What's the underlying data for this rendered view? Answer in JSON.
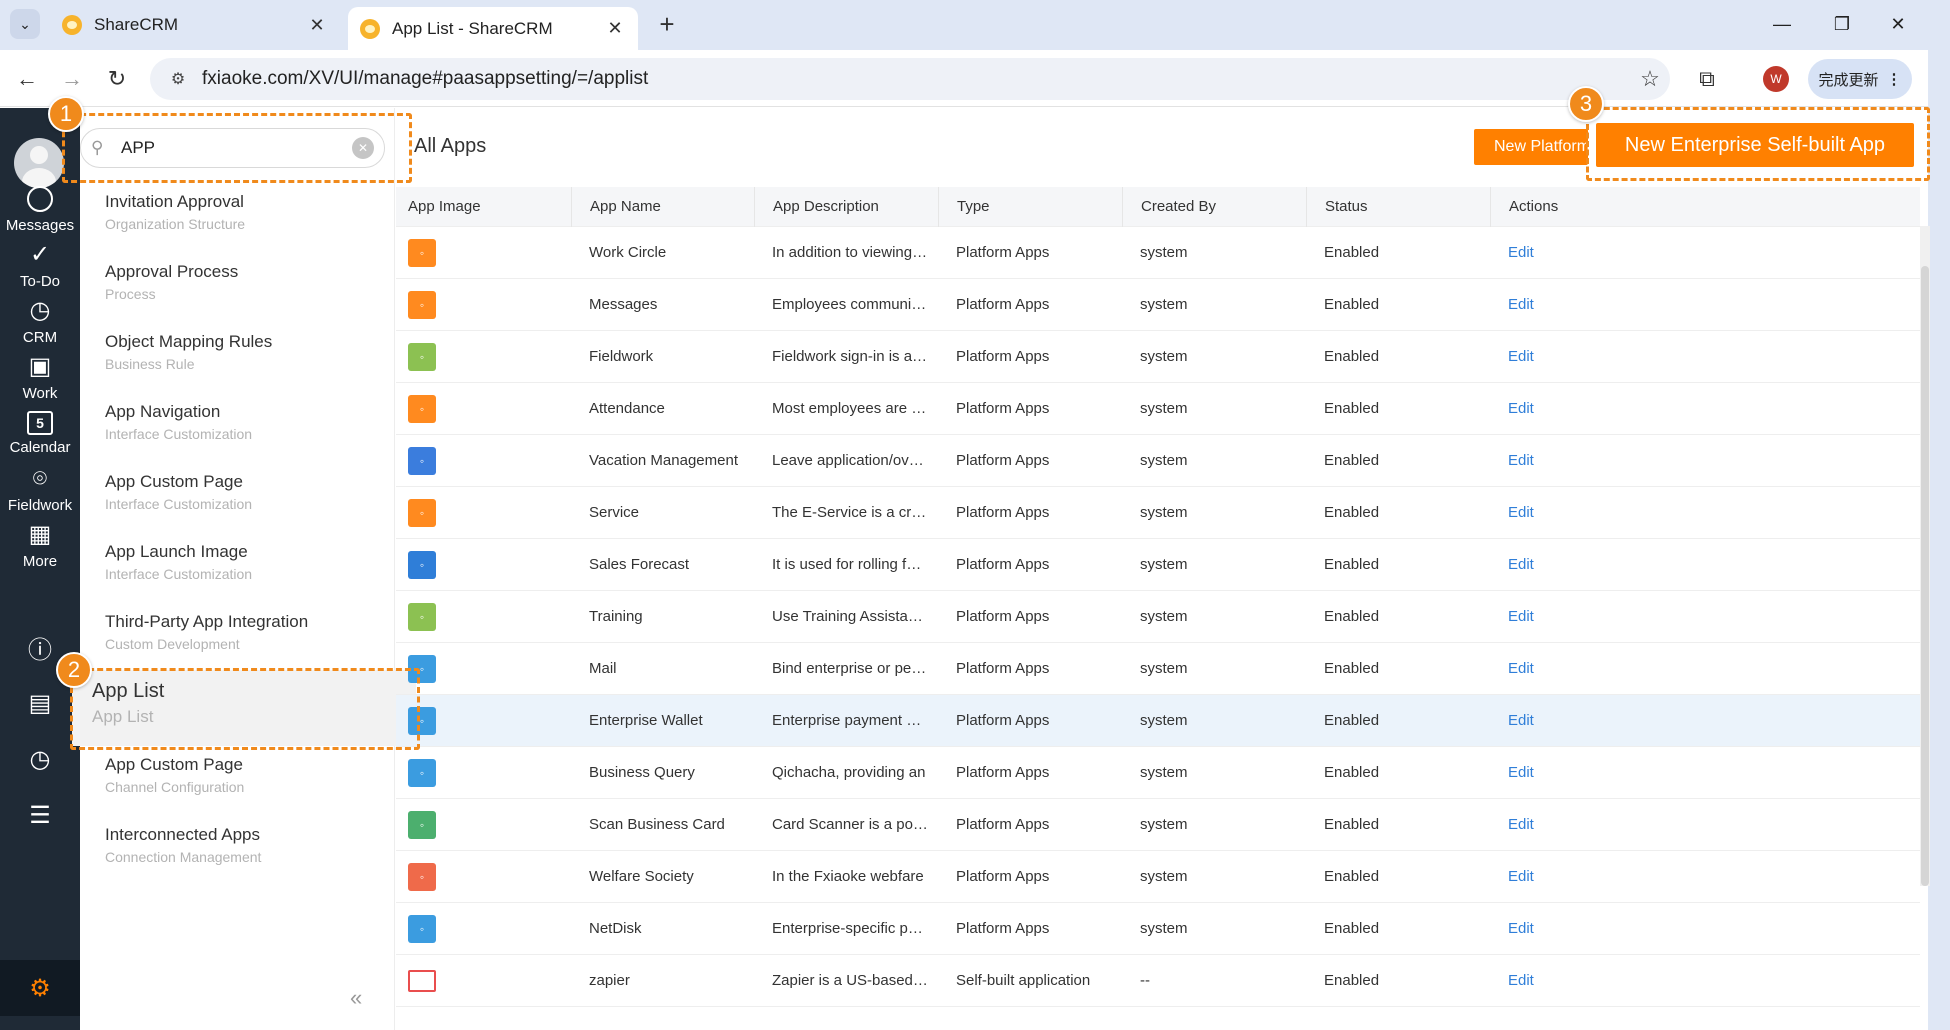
{
  "browser": {
    "tabs": [
      {
        "title": "ShareCRM",
        "active": false
      },
      {
        "title": "App List - ShareCRM",
        "active": true
      }
    ],
    "url": "fxiaoke.com/XV/UI/manage#paasappsetting/=/applist",
    "profile_initial": "W",
    "update_label": "完成更新"
  },
  "rail": {
    "items": [
      {
        "label": "Messages",
        "icon": "chat-bubble-icon"
      },
      {
        "label": "To-Do",
        "icon": "check-circle-icon"
      },
      {
        "label": "CRM",
        "icon": "clock-icon"
      },
      {
        "label": "Work",
        "icon": "briefcase-icon"
      },
      {
        "label": "Calendar",
        "icon": "calendar-icon",
        "day": "5"
      },
      {
        "label": "Fieldwork",
        "icon": "location-pin-icon"
      },
      {
        "label": "More",
        "icon": "grid-icon"
      }
    ]
  },
  "sidebar": {
    "search_value": "APP",
    "items": [
      {
        "title": "Invitation Approval",
        "subtitle": "Organization Structure"
      },
      {
        "title": "Approval Process",
        "subtitle": "Process"
      },
      {
        "title": "Object Mapping Rules",
        "subtitle": "Business Rule"
      },
      {
        "title": "App Navigation",
        "subtitle": "Interface Customization"
      },
      {
        "title": "App Custom Page",
        "subtitle": "Interface Customization"
      },
      {
        "title": "App Launch Image",
        "subtitle": "Interface Customization"
      },
      {
        "title": "Third-Party App Integration",
        "subtitle": "Custom Development"
      },
      {
        "title": "App List",
        "subtitle": "App List",
        "selected": true
      },
      {
        "title": "App Custom Page",
        "subtitle": "Channel Configuration"
      },
      {
        "title": "Interconnected Apps",
        "subtitle": "Connection Management"
      }
    ],
    "collapse_glyph": "«"
  },
  "main": {
    "title": "All Apps",
    "new_platform_label": "New Platform App",
    "new_self_built_label": "New Enterprise Self-built App",
    "columns": [
      "App Image",
      "App Name",
      "App Description",
      "Type",
      "Created By",
      "Status",
      "Actions"
    ],
    "rows": [
      {
        "color": "#ff8a1f",
        "name": "Work Circle",
        "desc": "In addition to viewing colleagues' updates",
        "type": "Platform Apps",
        "by": "system",
        "status": "Enabled",
        "action": "Edit"
      },
      {
        "color": "#ff8a1f",
        "name": "Messages",
        "desc": "Employees communicate in real time",
        "type": "Platform Apps",
        "by": "system",
        "status": "Enabled",
        "action": "Edit"
      },
      {
        "color": "#8cc152",
        "name": "Fieldwork",
        "desc": "Fieldwork sign-in is a mobile tool",
        "type": "Platform Apps",
        "by": "system",
        "status": "Enabled",
        "action": "Edit"
      },
      {
        "color": "#ff8a1f",
        "name": "Attendance",
        "desc": "Most employees are that used",
        "type": "Platform Apps",
        "by": "system",
        "status": "Enabled",
        "action": "Edit"
      },
      {
        "color": "#3b7ddd",
        "name": "Vacation Management",
        "desc": "Leave application/overtime",
        "type": "Platform Apps",
        "by": "system",
        "status": "Enabled",
        "action": "Edit"
      },
      {
        "color": "#ff8a1f",
        "name": "Service",
        "desc": "The E-Service is a cross-platform",
        "type": "Platform Apps",
        "by": "system",
        "status": "Enabled",
        "action": "Edit"
      },
      {
        "color": "#2f7ed8",
        "name": "Sales Forecast",
        "desc": "It is used for rolling forecast",
        "type": "Platform Apps",
        "by": "system",
        "status": "Enabled",
        "action": "Edit"
      },
      {
        "color": "#8cc152",
        "name": "Training",
        "desc": "Use Training Assistant to",
        "type": "Platform Apps",
        "by": "system",
        "status": "Enabled",
        "action": "Edit"
      },
      {
        "color": "#3b9ce0",
        "name": "Mail",
        "desc": "Bind enterprise or personal",
        "type": "Platform Apps",
        "by": "system",
        "status": "Enabled",
        "action": "Edit"
      },
      {
        "color": "#3b9ce0",
        "name": "Enterprise Wallet",
        "desc": "Enterprise payment account",
        "type": "Platform Apps",
        "by": "system",
        "status": "Enabled",
        "action": "Edit",
        "highlight": true
      },
      {
        "color": "#3b9ce0",
        "name": "Business Query",
        "desc": "Qichacha, providing an",
        "type": "Platform Apps",
        "by": "system",
        "status": "Enabled",
        "action": "Edit"
      },
      {
        "color": "#4caf6e",
        "name": "Scan Business Card",
        "desc": "Card Scanner is a powerful",
        "type": "Platform Apps",
        "by": "system",
        "status": "Enabled",
        "action": "Edit"
      },
      {
        "color": "#ef6a4a",
        "name": "Welfare Society",
        "desc": "In the Fxiaoke webfare",
        "type": "Platform Apps",
        "by": "system",
        "status": "Enabled",
        "action": "Edit"
      },
      {
        "color": "#3b9ce0",
        "name": "NetDisk",
        "desc": "Enterprise-specific public",
        "type": "Platform Apps",
        "by": "system",
        "status": "Enabled",
        "action": "Edit"
      },
      {
        "color": "#e94e4e",
        "name": "zapier",
        "desc": "Zapier is a US-based platform",
        "type": "Self-built application",
        "by": "--",
        "status": "Enabled",
        "action": "Edit",
        "outline": true
      }
    ]
  },
  "annotations": [
    "1",
    "2",
    "3"
  ]
}
